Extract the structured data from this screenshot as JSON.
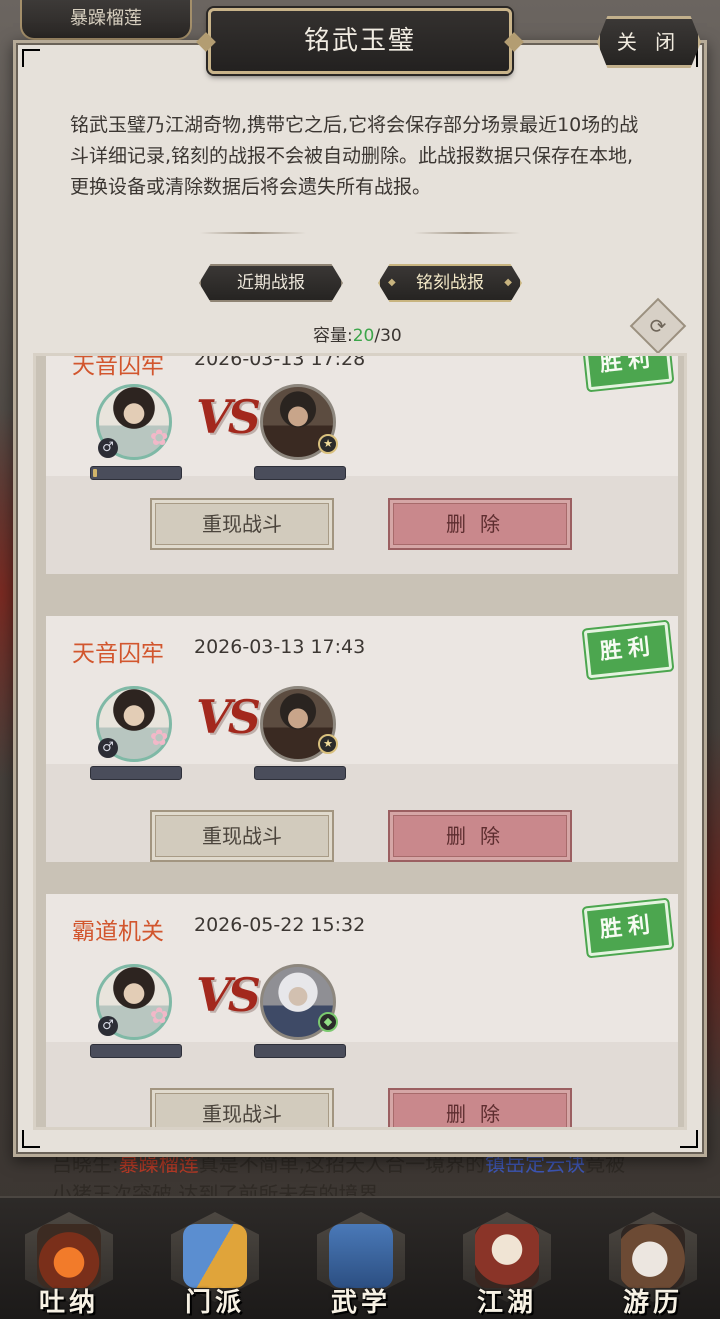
{
  "background": {
    "top_tab": "暴躁榴莲",
    "chat_line": {
      "part1": "吕晓生:",
      "name": "暴躁榴莲",
      "part2": "真是不简单,这招天人合一境界的",
      "skill": "镇岳定云诀",
      "part3": "竟被"
    },
    "chat_line2": "小猪王次突破,达到了前所未有的境界"
  },
  "modal": {
    "title": "铭武玉璧",
    "close_label": "关 闭",
    "description": "铭武玉璧乃江湖奇物,携带它之后,它将会保存部分场景最近10场的战斗详细记录,铭刻的战报不会被自动删除。此战报数据只保存在本地,更换设备或清除数据后将会遗失所有战报。",
    "tabs": [
      {
        "label": "近期战报",
        "active": false
      },
      {
        "label": "铭刻战报",
        "active": true
      }
    ],
    "capacity": {
      "label": "容量:",
      "used": "20",
      "total": "/30"
    },
    "refresh_icon": "refresh-icon",
    "records": [
      {
        "title": "天音囚牢",
        "time": "2026-03-13 17:28",
        "result": "胜利",
        "vs": "VS",
        "replay_label": "重现战斗",
        "delete_label": "删除"
      },
      {
        "title": "天音囚牢",
        "time": "2026-03-13 17:43",
        "result": "胜利",
        "vs": "VS",
        "replay_label": "重现战斗",
        "delete_label": "删除"
      },
      {
        "title": "霸道机关",
        "time": "2026-05-22 15:32",
        "result": "胜利",
        "vs": "VS",
        "replay_label": "重现战斗",
        "delete_label": "删除"
      }
    ]
  },
  "nav": {
    "items": [
      {
        "label": "吐纳",
        "icon": "meditation-icon"
      },
      {
        "label": "门派",
        "icon": "sect-icon"
      },
      {
        "label": "武学",
        "icon": "martial-book-icon"
      },
      {
        "label": "江湖",
        "icon": "jianghu-hat-icon"
      },
      {
        "label": "游历",
        "icon": "travel-horse-icon"
      }
    ]
  },
  "colors": {
    "accent_title": "#d2562e",
    "win_badge": "#4ca64f",
    "capacity_used": "#3ca54a",
    "delete_button": "#c9888c"
  }
}
